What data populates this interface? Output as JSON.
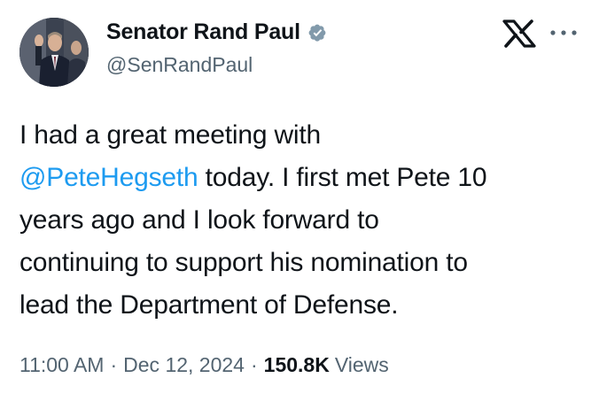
{
  "author": {
    "display_name": "Senator Rand Paul",
    "handle": "@SenRandPaul",
    "verified": true,
    "verified_color": "#829aab"
  },
  "tweet": {
    "lines": [
      [
        "I had a great meeting with"
      ],
      [
        "@PeteHegseth",
        " today. I first met Pete 10"
      ],
      [
        "years ago and I look forward to"
      ],
      [
        "continuing to support his nomination to"
      ],
      [
        "lead the Department of Defense."
      ]
    ],
    "mention": "@PeteHegseth",
    "mention_color": "#1d9bf0"
  },
  "meta": {
    "time": "11:00 AM",
    "separator": "·",
    "date": "Dec 12, 2024",
    "views_count": "150.8K",
    "views_label": "Views"
  },
  "icons": {
    "x_logo": "x-logo-icon",
    "more": "more-options-icon",
    "verified": "verified-badge-icon"
  },
  "colors": {
    "text_primary": "#0f1419",
    "text_secondary": "#536471",
    "link": "#1d9bf0",
    "background": "#ffffff"
  }
}
